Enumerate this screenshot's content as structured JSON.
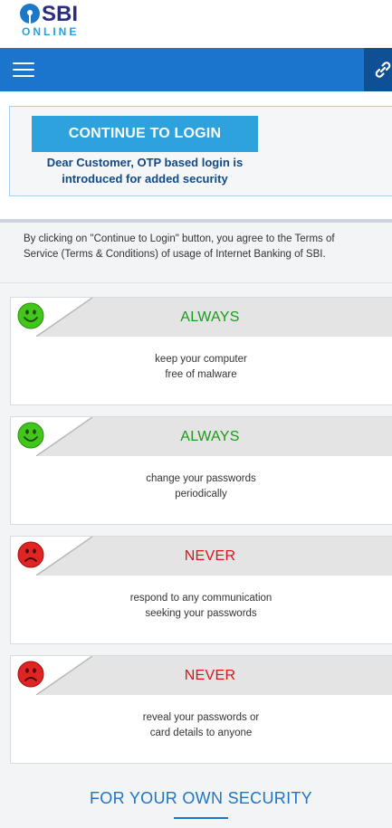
{
  "brand": {
    "logo_text": "SBI",
    "logo_sub": "ONLINE"
  },
  "navbar": {
    "menu_icon": "hamburger-icon",
    "link_icon": "link-icon"
  },
  "login": {
    "button_label": "CONTINUE TO LOGIN",
    "note": "Dear Customer, OTP based login is introduced for added security"
  },
  "terms": {
    "text": "By clicking on \"Continue to Login\" button, you agree to the Terms of Service (Terms & Conditions) of usage of Internet Banking of SBI."
  },
  "tips": [
    {
      "title": "ALWAYS",
      "line1": "keep your computer",
      "line2": "free of malware",
      "face": "smiley-icon",
      "tone": "good"
    },
    {
      "title": "ALWAYS",
      "line1": "change your passwords",
      "line2": "periodically",
      "face": "smiley-icon",
      "tone": "good"
    },
    {
      "title": "NEVER",
      "line1": "respond to any communication",
      "line2": "seeking your passwords",
      "face": "sad-face-icon",
      "tone": "bad"
    },
    {
      "title": "NEVER",
      "line1": "reveal your passwords or",
      "line2": "card details to anyone",
      "face": "sad-face-icon",
      "tone": "bad"
    }
  ],
  "footer": {
    "title": "FOR YOUR OWN SECURITY"
  },
  "colors": {
    "nav_blue": "#1b75cc",
    "button_blue": "#2ea2dd",
    "good_green": "#1b9a1b",
    "bad_red": "#d4161c"
  }
}
